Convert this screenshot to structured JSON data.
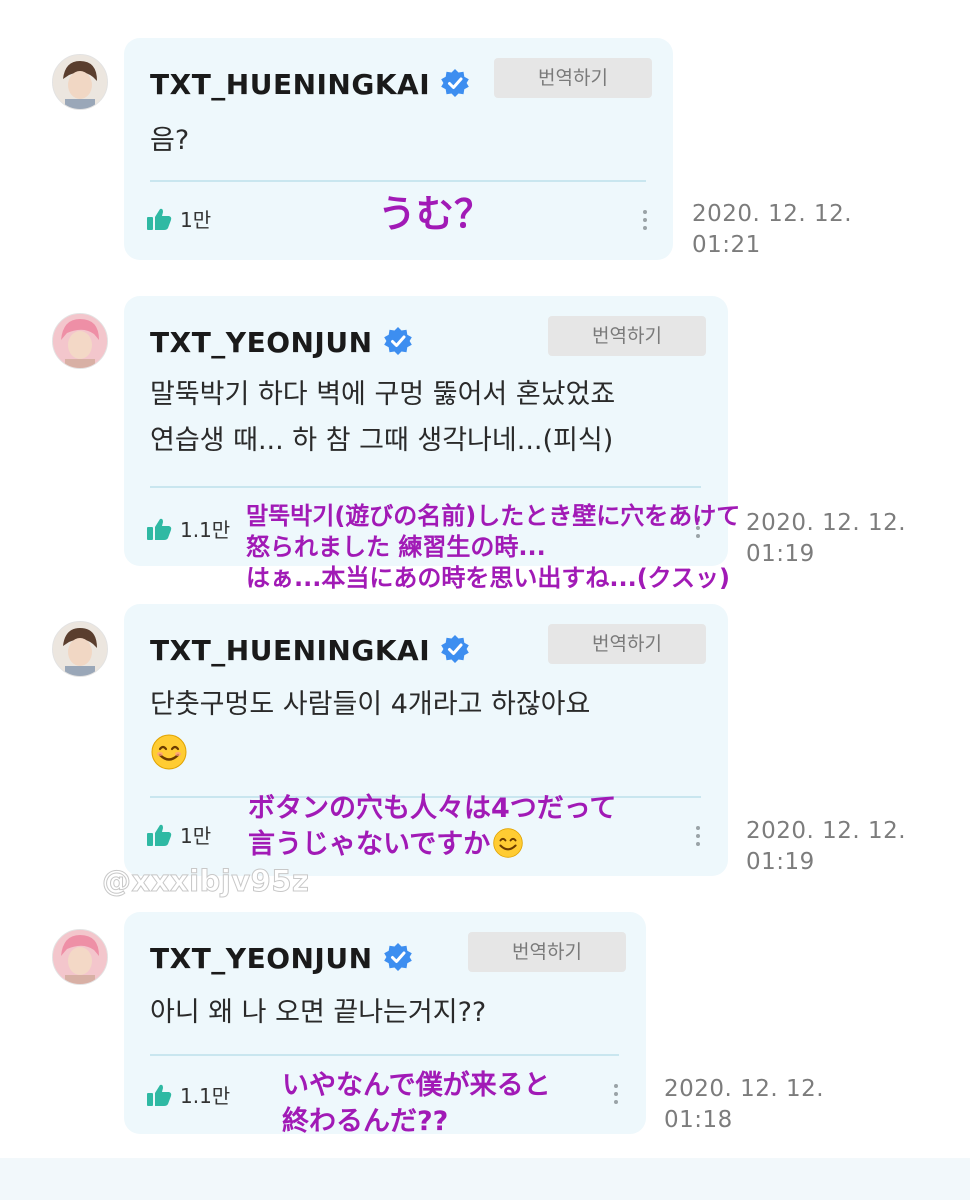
{
  "comments": [
    {
      "username": "TXT_HUENINGKAI",
      "translate_label": "번역하기",
      "text_lines": [
        "음?"
      ],
      "likes": "1만",
      "date": "2020. 12. 12.",
      "time": "01:21",
      "jp_translation": [
        "うむ？"
      ]
    },
    {
      "username": "TXT_YEONJUN",
      "translate_label": "번역하기",
      "text_lines": [
        "말뚝박기 하다 벽에 구멍 뚫어서 혼났었죠",
        "연습생 때... 하 참 그때 생각나네...(피식)"
      ],
      "likes": "1.1만",
      "date": "2020. 12. 12.",
      "time": "01:19",
      "jp_translation": [
        "말뚝박기(遊びの名前)したとき壁に穴をあけて",
        "怒られました 練習生の時...",
        "はぁ...本当にあの時を思い出すね...(クスッ)"
      ]
    },
    {
      "username": "TXT_HUENINGKAI",
      "translate_label": "번역하기",
      "text_lines": [
        "단춧구멍도 사람들이 4개라고 하잖아요"
      ],
      "likes": "1만",
      "date": "2020. 12. 12.",
      "time": "01:19",
      "jp_translation": [
        "ボタンの穴も人々は4つだって",
        "言うじゃないですか"
      ]
    },
    {
      "username": "TXT_YEONJUN",
      "translate_label": "번역하기",
      "text_lines": [
        "아니 왜 나 오면 끝나는거지??"
      ],
      "likes": "1.1만",
      "date": "2020. 12. 12.",
      "time": "01:18",
      "jp_translation": [
        "いやなんで僕が来ると",
        "終わるんだ??"
      ]
    }
  ],
  "watermark": "@xxxibjv95z",
  "icons": {
    "verified": "verified-badge-icon",
    "like": "thumbs-up-icon",
    "more": "more-vertical-icon",
    "emoji": "smiling-face-emoji"
  },
  "colors": {
    "bubble": "#eef8fc",
    "verified": "#3d8ef0",
    "like": "#2fb9a3",
    "annotation": "#a11ab6"
  }
}
